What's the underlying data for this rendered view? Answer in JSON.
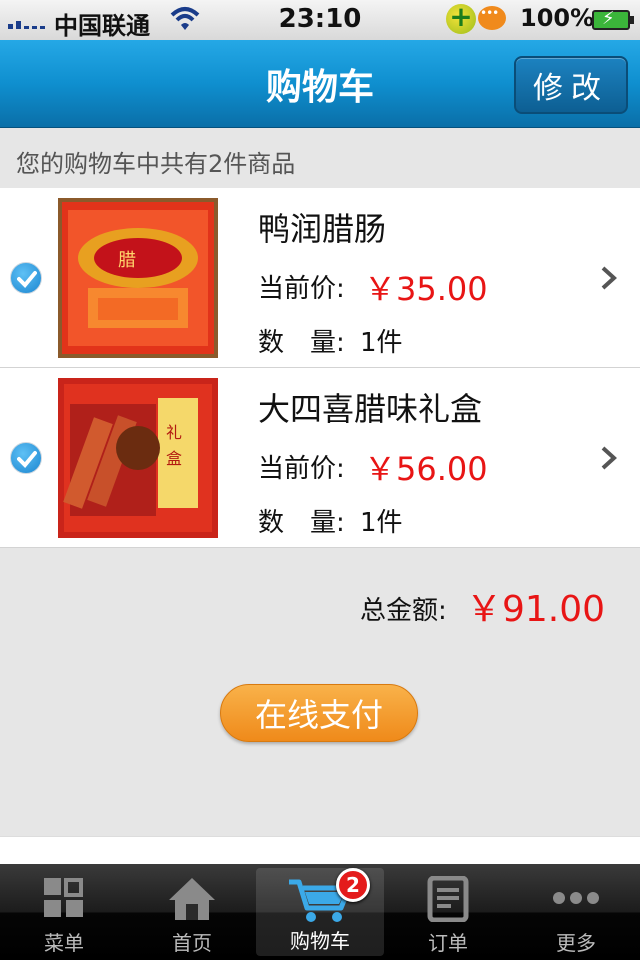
{
  "status_bar": {
    "carrier": "中国联通",
    "time": "23:10",
    "battery": "100%"
  },
  "nav": {
    "title": "购物车",
    "edit_label": "修改"
  },
  "summary": "您的购物车中共有2件商品",
  "items": [
    {
      "name": "鸭润腊肠",
      "price_label": "当前价:",
      "price": "￥35.00",
      "qty_label": "数　量:",
      "qty": "1件",
      "checked": true
    },
    {
      "name": "大四喜腊味礼盒",
      "price_label": "当前价:",
      "price": "￥56.00",
      "qty_label": "数　量:",
      "qty": "1件",
      "checked": true
    }
  ],
  "total": {
    "label": "总金额:",
    "value": "￥91.00"
  },
  "pay_button": "在线支付",
  "tabs": [
    {
      "label": "菜单",
      "icon": "grid-icon"
    },
    {
      "label": "首页",
      "icon": "home-icon"
    },
    {
      "label": "购物车",
      "icon": "cart-icon",
      "badge": "2",
      "active": true
    },
    {
      "label": "订单",
      "icon": "document-icon"
    },
    {
      "label": "更多",
      "icon": "more-icon"
    }
  ],
  "colors": {
    "accent": "#0f8fcf",
    "price": "#e81515",
    "pay": "#ef8a1a"
  }
}
